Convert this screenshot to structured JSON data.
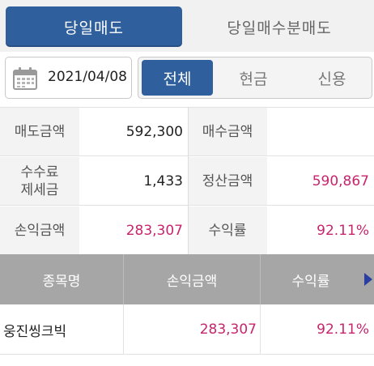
{
  "top_tabs": [
    {
      "label": "당일매도",
      "active": true
    },
    {
      "label": "당일매수분매도",
      "active": false
    }
  ],
  "date": {
    "value": "2021/04/08",
    "icon": "calendar-icon"
  },
  "filter_tabs": [
    {
      "label": "전체",
      "active": true
    },
    {
      "label": "현금",
      "active": false
    },
    {
      "label": "신용",
      "active": false
    }
  ],
  "summary": {
    "sell_amount_label": "매도금액",
    "sell_amount_value": "592,300",
    "buy_amount_label": "매수금액",
    "buy_amount_value": "",
    "fee_label_line1": "수수료",
    "fee_label_line2": "제세금",
    "fee_value": "1,433",
    "settlement_label": "정산금액",
    "settlement_value": "590,867",
    "profit_label": "손익금액",
    "profit_value": "283,307",
    "return_label": "수익률",
    "return_value": "92.11%"
  },
  "table": {
    "headers": [
      "종목명",
      "손익금액",
      "수익률"
    ],
    "rows": [
      {
        "name": "웅진씽크빅",
        "profit": "283,307",
        "return": "92.11%"
      }
    ]
  },
  "colors": {
    "accent": "#2f5f9c",
    "positive": "#c8246d",
    "header_bg": "#a6a6a6"
  }
}
